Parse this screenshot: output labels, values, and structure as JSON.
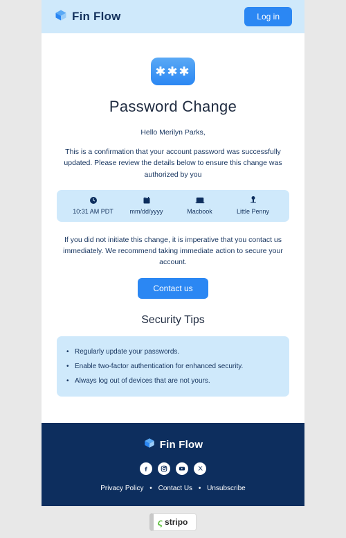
{
  "header": {
    "brand_name": "Fin Flow",
    "login_label": "Log in"
  },
  "main": {
    "title": "Password Change",
    "greeting": "Hello Merilyn Parks,",
    "body1": "This is a confirmation that your account password was successfully updated. Please review the details below to ensure this change was authorized by you",
    "details": {
      "time": "10:31 AM PDT",
      "date": "mm/dd/yyyy",
      "device": "Macbook",
      "location": "Little Penny"
    },
    "body2": "If you did not initiate this change, it is imperative that you contact us immediately. We recommend taking immediate action to secure your account.",
    "contact_label": "Contact us",
    "tips_title": "Security Tips",
    "tips": [
      "Regularly update your passwords.",
      "Enable two-factor authentication for enhanced security.",
      "Always log out of devices that are not yours."
    ]
  },
  "footer": {
    "brand_name": "Fin Flow",
    "links": {
      "privacy": "Privacy Policy",
      "contact": "Contact Us",
      "unsubscribe": "Unsubscribe"
    }
  },
  "badge": {
    "text": "stripo"
  }
}
